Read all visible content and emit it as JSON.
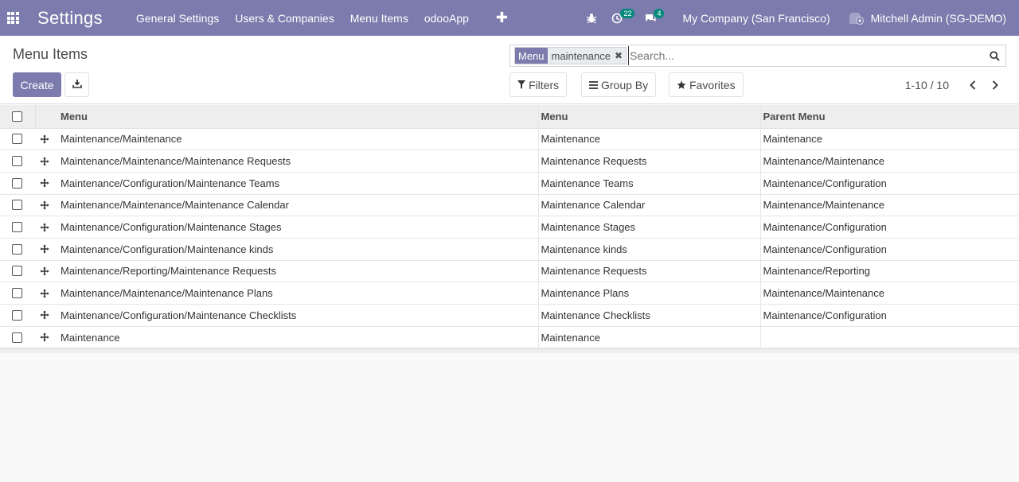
{
  "navbar": {
    "app_title": "Settings",
    "menu": [
      "General Settings",
      "Users & Companies",
      "Menu Items",
      "odooApp"
    ],
    "activity_count": "22",
    "message_count": "4",
    "company": "My Company (San Francisco)",
    "user": "Mitchell Admin (SG-DEMO)"
  },
  "control_panel": {
    "breadcrumb": "Menu Items",
    "create_label": "Create",
    "search": {
      "facet_label": "Menu",
      "facet_value": "maintenance",
      "placeholder": "Search..."
    },
    "filters_label": "Filters",
    "groupby_label": "Group By",
    "favorites_label": "Favorites",
    "pager_value": "1-10 / 10"
  },
  "table": {
    "headers": [
      "Menu",
      "Menu",
      "Parent Menu"
    ],
    "rows": [
      [
        "Maintenance/Maintenance",
        "Maintenance",
        "Maintenance"
      ],
      [
        "Maintenance/Maintenance/Maintenance Requests",
        "Maintenance Requests",
        "Maintenance/Maintenance"
      ],
      [
        "Maintenance/Configuration/Maintenance Teams",
        "Maintenance Teams",
        "Maintenance/Configuration"
      ],
      [
        "Maintenance/Maintenance/Maintenance Calendar",
        "Maintenance Calendar",
        "Maintenance/Maintenance"
      ],
      [
        "Maintenance/Configuration/Maintenance Stages",
        "Maintenance Stages",
        "Maintenance/Configuration"
      ],
      [
        "Maintenance/Configuration/Maintenance kinds",
        "Maintenance kinds",
        "Maintenance/Configuration"
      ],
      [
        "Maintenance/Reporting/Maintenance Requests",
        "Maintenance Requests",
        "Maintenance/Reporting"
      ],
      [
        "Maintenance/Maintenance/Maintenance Plans",
        "Maintenance Plans",
        "Maintenance/Maintenance"
      ],
      [
        "Maintenance/Configuration/Maintenance Checklists",
        "Maintenance Checklists",
        "Maintenance/Configuration"
      ],
      [
        "Maintenance",
        "Maintenance",
        ""
      ]
    ]
  },
  "colors": {
    "brand": "#7c7bad",
    "badge": "#01897b"
  }
}
